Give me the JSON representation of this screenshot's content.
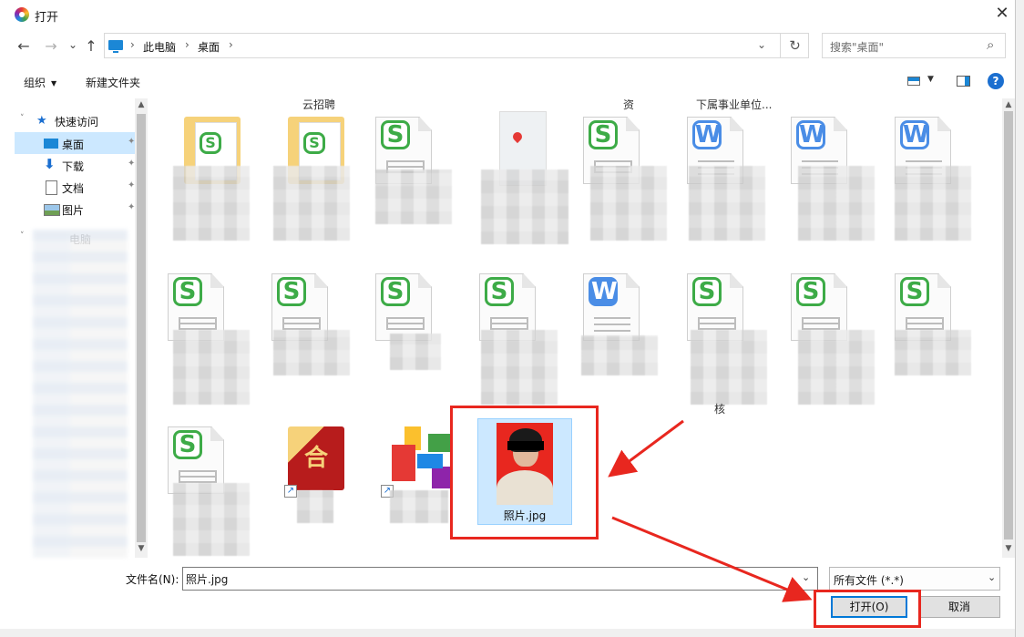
{
  "window": {
    "title": "打开",
    "close": "✕"
  },
  "nav": {
    "back": "←",
    "forward": "→",
    "recent": "⌄",
    "up": "↑"
  },
  "address": {
    "pc": "此电脑",
    "sep": "›",
    "folder": "桌面",
    "dropdown": "⌄",
    "refresh": "↻"
  },
  "search": {
    "placeholder": "搜索\"桌面\"",
    "icon": "search-icon"
  },
  "toolbar": {
    "organize": "组织",
    "new_folder": "新建文件夹",
    "help": "?"
  },
  "sidebar": {
    "quick_access": "快速访问",
    "items": [
      {
        "label": "桌面",
        "icon": "desktop-icon",
        "pinned": true,
        "selected": true
      },
      {
        "label": "下载",
        "icon": "download-icon",
        "pinned": true
      },
      {
        "label": "文档",
        "icon": "document-icon",
        "pinned": true
      },
      {
        "label": "图片",
        "icon": "picture-icon",
        "pinned": true
      }
    ],
    "pin": "📌",
    "this_pc_partial": "电脑"
  },
  "files": {
    "top_partial_labels": [
      "云招聘",
      "资",
      "下属事业单位..."
    ],
    "selected_file": "照片.jpg",
    "partial_label": "核"
  },
  "bottom": {
    "filename_label": "文件名(N):",
    "filename_value": "照片.jpg",
    "filetype": "所有文件 (*.*)",
    "open_button": "打开(O)",
    "cancel_button": "取消"
  },
  "colors": {
    "selection": "#cce8ff",
    "accent": "#0078d7",
    "highlight": "#e8271f",
    "wps_green": "#3dab47",
    "wps_blue": "#4a8de6"
  }
}
